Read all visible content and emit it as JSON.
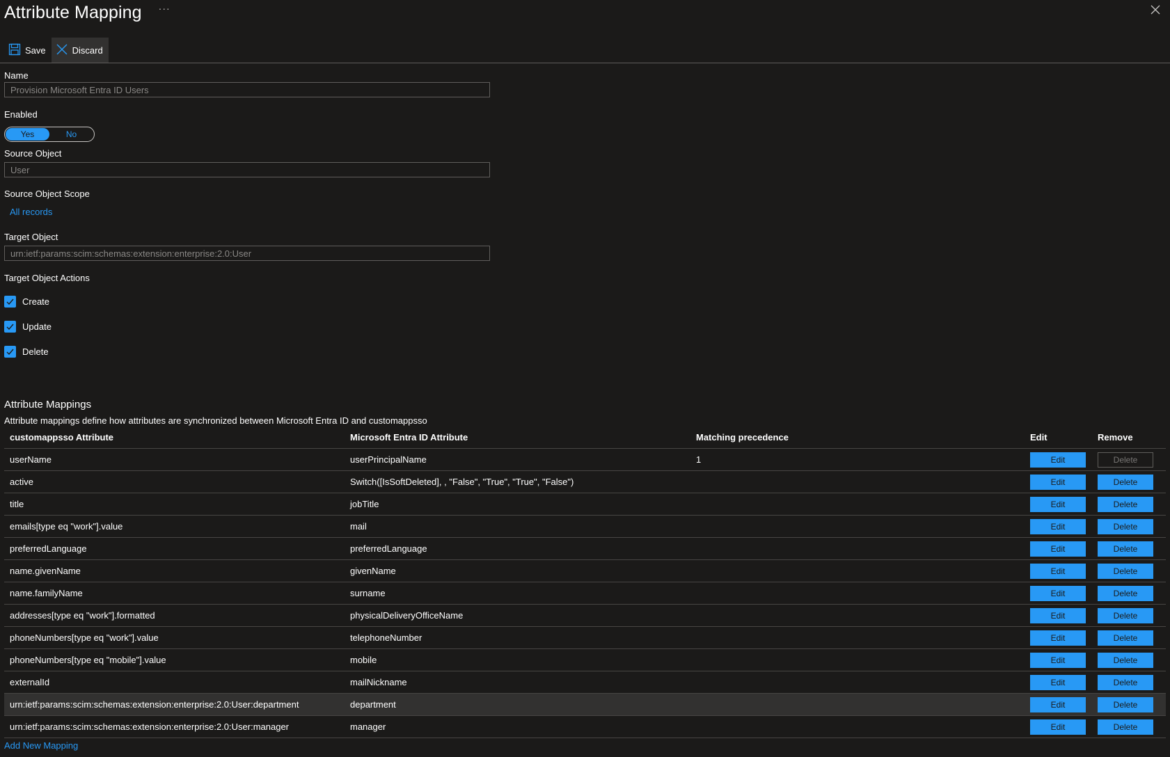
{
  "header": {
    "title": "Attribute Mapping",
    "more": "···"
  },
  "toolbar": {
    "save_label": "Save",
    "discard_label": "Discard"
  },
  "form": {
    "name_label": "Name",
    "name_value": "Provision Microsoft Entra ID Users",
    "enabled_label": "Enabled",
    "enabled_yes": "Yes",
    "enabled_no": "No",
    "enabled_selected": "Yes",
    "source_object_label": "Source Object",
    "source_object_value": "User",
    "source_scope_label": "Source Object Scope",
    "source_scope_link": "All records",
    "target_object_label": "Target Object",
    "target_object_value": "urn:ietf:params:scim:schemas:extension:enterprise:2.0:User",
    "target_actions_label": "Target Object Actions",
    "actions": [
      {
        "label": "Create",
        "checked": true
      },
      {
        "label": "Update",
        "checked": true
      },
      {
        "label": "Delete",
        "checked": true
      }
    ]
  },
  "mappings": {
    "title": "Attribute Mappings",
    "description": "Attribute mappings define how attributes are synchronized between Microsoft Entra ID and customappsso",
    "columns": [
      "customappsso Attribute",
      "Microsoft Entra ID Attribute",
      "Matching precedence",
      "Edit",
      "Remove"
    ],
    "edit_label": "Edit",
    "delete_label": "Delete",
    "rows": [
      {
        "target": "userName",
        "source": "userPrincipalName",
        "precedence": "1"
      },
      {
        "target": "active",
        "source": "Switch([IsSoftDeleted], , \"False\", \"True\", \"True\", \"False\")",
        "precedence": ""
      },
      {
        "target": "title",
        "source": "jobTitle",
        "precedence": ""
      },
      {
        "target": "emails[type eq \"work\"].value",
        "source": "mail",
        "precedence": ""
      },
      {
        "target": "preferredLanguage",
        "source": "preferredLanguage",
        "precedence": ""
      },
      {
        "target": "name.givenName",
        "source": "givenName",
        "precedence": ""
      },
      {
        "target": "name.familyName",
        "source": "surname",
        "precedence": ""
      },
      {
        "target": "addresses[type eq \"work\"].formatted",
        "source": "physicalDeliveryOfficeName",
        "precedence": ""
      },
      {
        "target": "phoneNumbers[type eq \"work\"].value",
        "source": "telephoneNumber",
        "precedence": ""
      },
      {
        "target": "phoneNumbers[type eq \"mobile\"].value",
        "source": "mobile",
        "precedence": ""
      },
      {
        "target": "externalId",
        "source": "mailNickname",
        "precedence": ""
      },
      {
        "target": "urn:ietf:params:scim:schemas:extension:enterprise:2.0:User:department",
        "source": "department",
        "precedence": ""
      },
      {
        "target": "urn:ietf:params:scim:schemas:extension:enterprise:2.0:User:manager",
        "source": "manager",
        "precedence": ""
      }
    ],
    "add_link": "Add New Mapping"
  },
  "colors": {
    "accent": "#2899f5",
    "background": "#1b1a19",
    "highlight_row": "#323130"
  }
}
